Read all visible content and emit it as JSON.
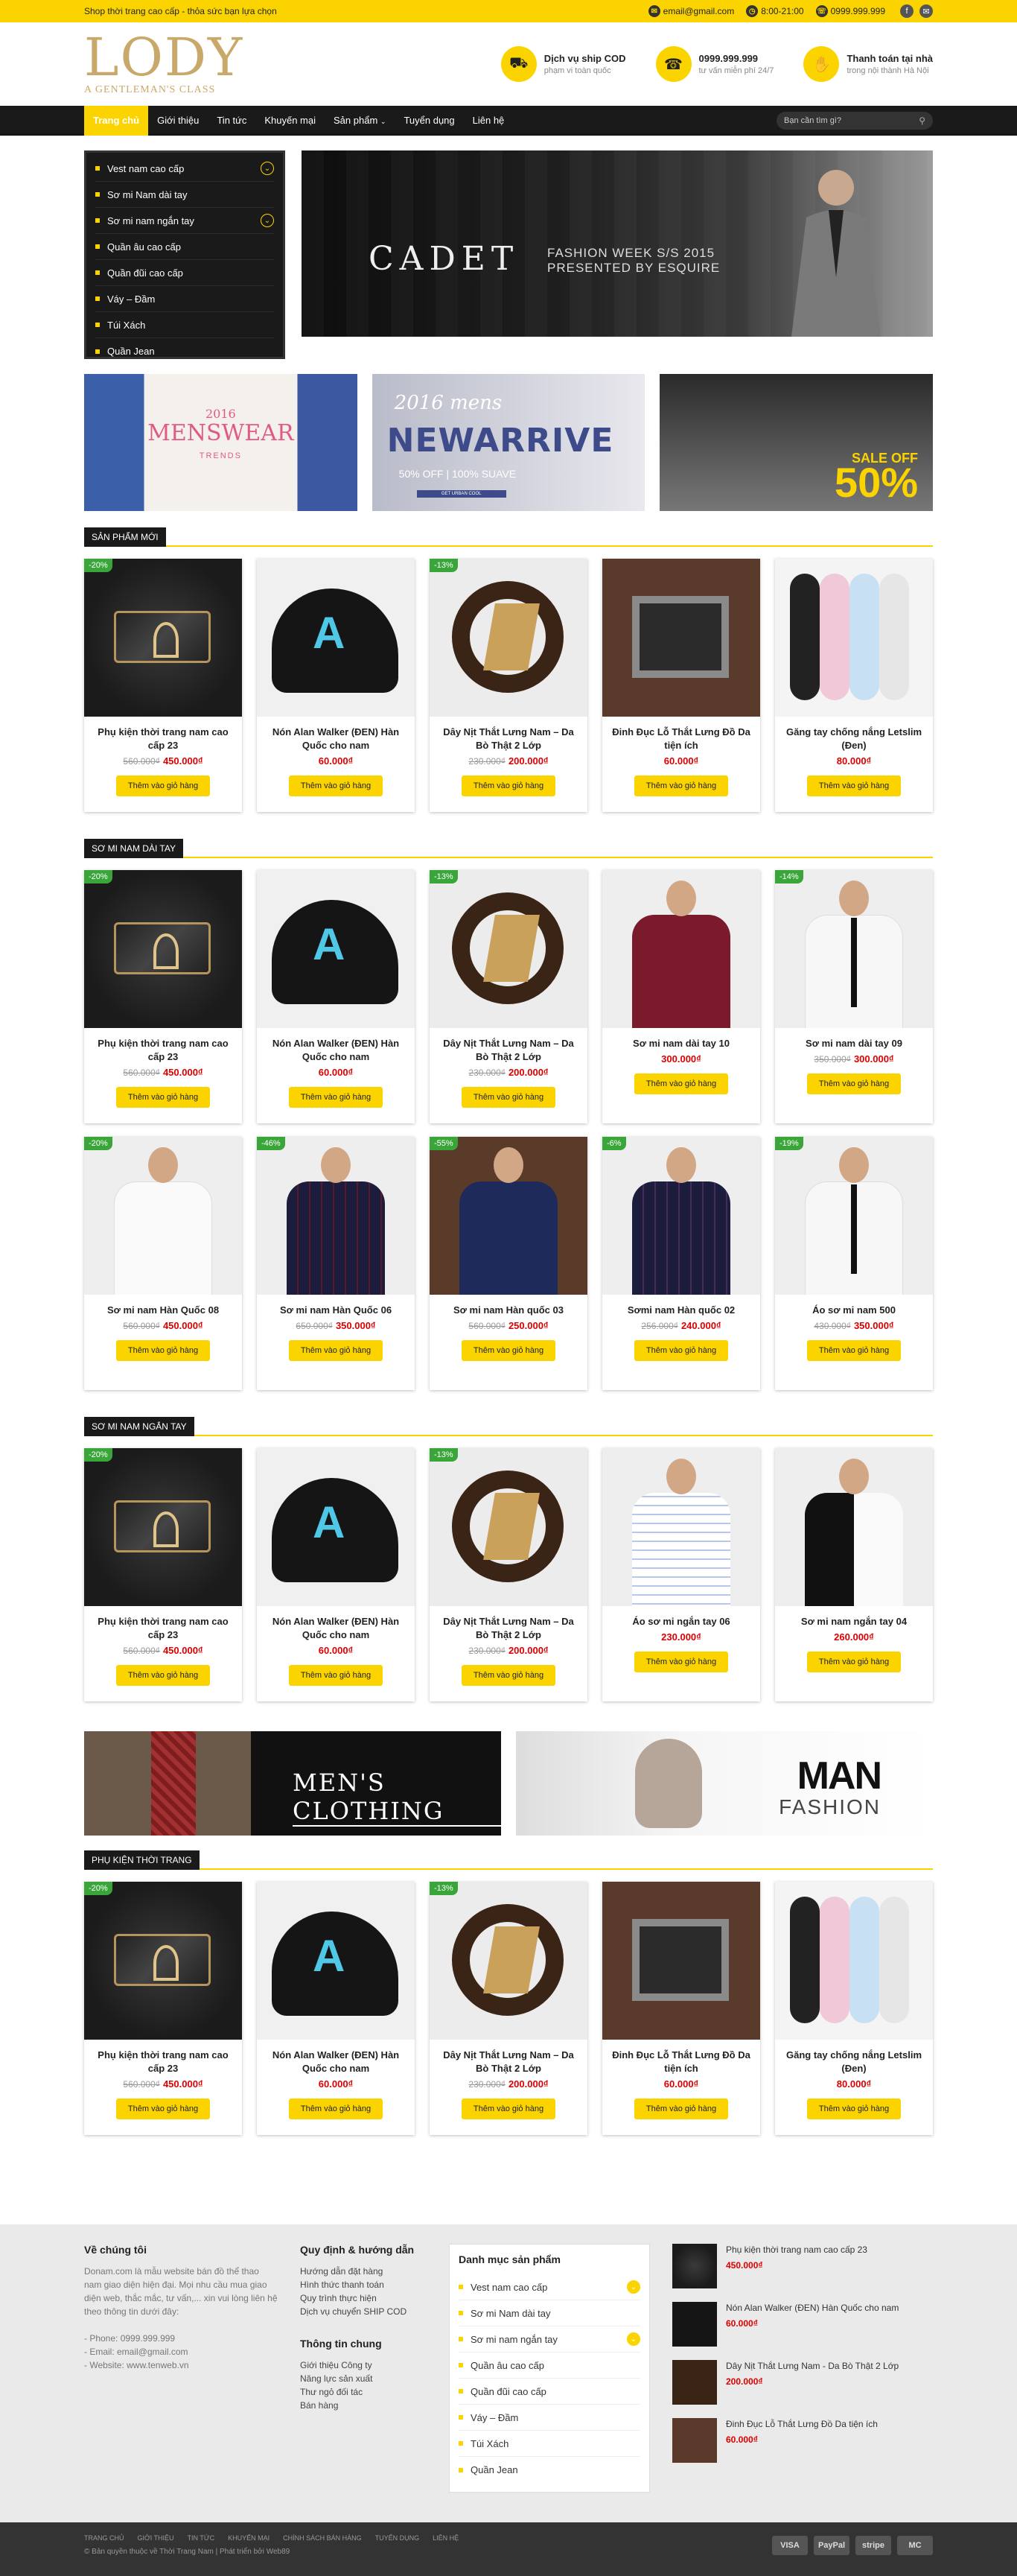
{
  "topbar": {
    "slogan": "Shop thời trang cao cấp - thỏa sức bạn lựa chọn",
    "email": "email@gmail.com",
    "hours": "8:00-21:00",
    "phone": "0999.999.999"
  },
  "header": {
    "logo_text": "LODY",
    "logo_sub": "A GENTLEMAN'S CLASS",
    "features": [
      {
        "title": "Dịch vụ ship COD",
        "sub": "phạm vi toàn quốc",
        "icon": "truck-icon"
      },
      {
        "title": "0999.999.999",
        "sub": "tư vấn miễn phí 24/7",
        "icon": "phone-icon"
      },
      {
        "title": "Thanh toán tại nhà",
        "sub": "trong nội thành Hà Nội",
        "icon": "handshake-icon"
      }
    ]
  },
  "nav": {
    "items": [
      "Trang chủ",
      "Giới thiệu",
      "Tin tức",
      "Khuyến mại",
      "Sản phẩm",
      "Tuyển dụng",
      "Liên hệ"
    ],
    "search_placeholder": "Bạn cần tìm gì?"
  },
  "categories": [
    "Vest nam cao cấp",
    "Sơ mi Nam dài tay",
    "Sơ mi nam ngắn tay",
    "Quần âu cao cấp",
    "Quần đũi cao cấp",
    "Váy – Đầm",
    "Túi Xách",
    "Quần Jean"
  ],
  "slider": {
    "brand": "CADET",
    "line1": "FASHION WEEK S/S 2015",
    "line2": "PRESENTED BY ESQUIRE"
  },
  "banners": {
    "b1_year": "2016",
    "b1_title": "MENSWEAR",
    "b1_sub": "TRENDS",
    "b2_year": "2016 mens",
    "b2_title": "NEWARRIVE",
    "b2_sub": "50% OFF | 100% SUAVE",
    "b2_bar": "GET URBAN COOL",
    "b3_title": "SALE OFF",
    "b3_pct": "50%"
  },
  "sections": [
    {
      "title": "SẢN PHẨM MỚI"
    },
    {
      "title": "SƠ MI NAM DÀI TAY"
    },
    {
      "title": "SƠ MI NAM NGẮN TAY"
    },
    {
      "title": "PHỤ KIỆN THỜI TRANG"
    }
  ],
  "products": {
    "p1": {
      "badge": "-20%",
      "name": "Phụ kiện thời trang nam cao cấp 23",
      "old": "560.000₫",
      "new": "450.000₫"
    },
    "p2": {
      "badge": "",
      "name": "Nón Alan Walker (ĐEN) Hàn Quốc cho nam",
      "old": "",
      "new": "60.000₫"
    },
    "p3": {
      "badge": "-13%",
      "name": "Dây Nịt Thắt Lưng Nam – Da Bò Thật 2 Lớp",
      "old": "230.000₫",
      "new": "200.000₫"
    },
    "p4": {
      "badge": "",
      "name": "Đinh Đục Lỗ Thắt Lưng Đồ Da tiện ích",
      "old": "",
      "new": "60.000₫"
    },
    "p5": {
      "badge": "",
      "name": "Găng tay chống nắng Letslim (Đen)",
      "old": "",
      "new": "80.000₫"
    },
    "p6": {
      "badge": "",
      "name": "Sơ mi nam dài tay 10",
      "old": "",
      "new": "300.000₫"
    },
    "p7": {
      "badge": "-14%",
      "name": "Sơ mi nam dài tay 09",
      "old": "350.000₫",
      "new": "300.000₫"
    },
    "p8": {
      "badge": "-20%",
      "name": "Sơ mi nam Hàn Quốc 08",
      "old": "560.000₫",
      "new": "450.000₫"
    },
    "p9": {
      "badge": "-46%",
      "name": "Sơ mi nam Hàn Quốc 06",
      "old": "650.000₫",
      "new": "350.000₫"
    },
    "p10": {
      "badge": "-55%",
      "name": "Sơ mi nam Hàn quốc 03",
      "old": "560.000₫",
      "new": "250.000₫"
    },
    "p11": {
      "badge": "-6%",
      "name": "Sơmi nam Hàn quốc 02",
      "old": "256.000₫",
      "new": "240.000₫"
    },
    "p12": {
      "badge": "-19%",
      "name": "Áo sơ mi nam 500",
      "old": "430.000₫",
      "new": "350.000₫"
    },
    "p13": {
      "badge": "",
      "name": "Áo sơ mi ngắn tay 06",
      "old": "",
      "new": "230.000₫"
    },
    "p14": {
      "badge": "",
      "name": "Sơ mi nam ngắn tay 04",
      "old": "",
      "new": "260.000₫"
    }
  },
  "add_to_cart": "Thêm vào giỏ hàng",
  "wide_banners": {
    "left": "MEN'S CLOTHING",
    "right1": "MAN",
    "right2": "FASHION"
  },
  "footer": {
    "about_title": "Về chúng tôi",
    "about_text": "Donam.com là mẫu website bán đồ thể thao nam giao diện hiện đại. Mọi nhu cầu mua giao diện web, thắc mắc, tư vấn,... xin vui lòng liên hệ theo thông tin dưới đây:",
    "contact": [
      "- Phone: 0999.999.999",
      "- Email: email@gmail.com",
      "- Website: www.tenweb.vn"
    ],
    "policy_title": "Quy định & hướng dẫn",
    "policy_links": [
      "Hướng dẫn đặt hàng",
      "Hình thức thanh toán",
      "Quy trình thực hiện",
      "Dịch vụ chuyển SHIP COD"
    ],
    "info_title": "Thông tin chung",
    "info_links": [
      "Giới thiệu Công ty",
      "Năng lực sản xuất",
      "Thư ngỏ đối tác",
      "Bán hàng"
    ],
    "cat_title": "Danh mục sản phẩm",
    "products": [
      {
        "name": "Phụ kiện thời trang nam cao cấp 23",
        "price": "450.000₫"
      },
      {
        "name": "Nón Alan Walker (ĐEN) Hàn Quốc cho nam",
        "price": "60.000₫"
      },
      {
        "name": "Dây Nịt Thắt Lưng Nam - Da Bò Thật 2 Lớp",
        "price": "200.000₫"
      },
      {
        "name": "Đinh Đục Lỗ Thắt Lưng Đồ Da tiện ích",
        "price": "60.000₫"
      }
    ],
    "bottom_links": [
      "Trang chủ",
      "Giới thiệu",
      "Tin tức",
      "Khuyến mại",
      "Chính sách bán hàng",
      "Tuyển dụng",
      "Liên hệ"
    ],
    "copyright": "© Bản quyền thuộc về Thời Trang Nam  |  Phát triển bởi Web89",
    "payments": [
      "VISA",
      "PayPal",
      "stripe",
      "MC"
    ]
  },
  "colors": {
    "accent": "#fbd400",
    "dark": "#1a1a1a",
    "price": "#dd0000",
    "badge": "#3aa63a"
  }
}
